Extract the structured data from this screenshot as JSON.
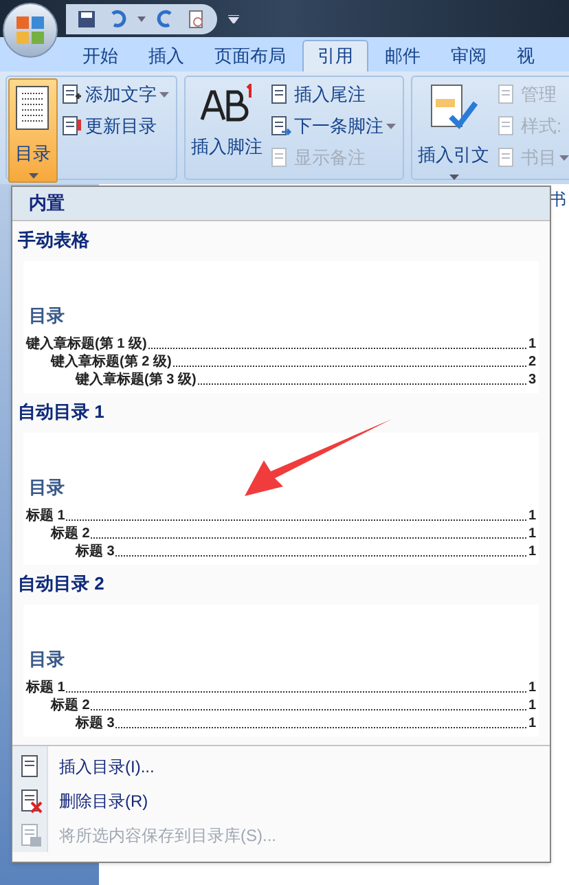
{
  "tabs": [
    {
      "label": "开始",
      "selected": false
    },
    {
      "label": "插入",
      "selected": false
    },
    {
      "label": "页面布局",
      "selected": false
    },
    {
      "label": "引用",
      "selected": true
    },
    {
      "label": "邮件",
      "selected": false
    },
    {
      "label": "审阅",
      "selected": false
    },
    {
      "label": "视",
      "selected": false
    }
  ],
  "ribbon": {
    "groups": [
      {
        "big": {
          "label": "目录",
          "pressed": true,
          "arrow": true
        },
        "small": [
          {
            "label": "添加文字",
            "disabled": false,
            "arrow": true
          },
          {
            "label": "更新目录",
            "disabled": false,
            "arrow": false
          }
        ]
      },
      {
        "big": {
          "label": "插入脚注",
          "pressed": false,
          "arrow": false
        },
        "small": [
          {
            "label": "插入尾注",
            "disabled": false,
            "arrow": false
          },
          {
            "label": "下一条脚注",
            "disabled": false,
            "arrow": true
          },
          {
            "label": "显示备注",
            "disabled": true,
            "arrow": false
          }
        ]
      },
      {
        "big": {
          "label": "插入引文",
          "pressed": false,
          "arrow": true
        },
        "small": [
          {
            "label": "管理",
            "disabled": true,
            "arrow": false
          },
          {
            "label": "样式:",
            "disabled": true,
            "arrow": false
          },
          {
            "label": "书目",
            "disabled": true,
            "arrow": true
          }
        ]
      }
    ],
    "group_label": "书"
  },
  "menu": {
    "header": "内置",
    "gallery": [
      {
        "title": "手动表格",
        "preview_title": "目录",
        "lines": [
          {
            "text": "键入章标题(第 1 级)",
            "page": "1",
            "children": [
              {
                "text": "键入章标题(第 2 级)",
                "page": "2",
                "children": [
                  {
                    "text": "键入章标题(第 3 级)",
                    "page": "3"
                  }
                ]
              }
            ]
          }
        ]
      },
      {
        "title": "自动目录 1",
        "preview_title": "目录",
        "lines": [
          {
            "text": "标题 1",
            "page": "1",
            "children": [
              {
                "text": "标题 2",
                "page": "1",
                "children": [
                  {
                    "text": "标题 3",
                    "page": "1"
                  }
                ]
              }
            ]
          }
        ]
      },
      {
        "title": "自动目录 2",
        "preview_title": "目录",
        "lines": [
          {
            "text": "标题 1",
            "page": "1",
            "children": [
              {
                "text": "标题 2",
                "page": "1",
                "children": [
                  {
                    "text": "标题 3",
                    "page": "1"
                  }
                ]
              }
            ]
          }
        ]
      }
    ],
    "items": [
      {
        "label": "插入目录(I)...",
        "disabled": false
      },
      {
        "label": "删除目录(R)",
        "disabled": false
      },
      {
        "label": "将所选内容保存到目录库(S)...",
        "disabled": true
      }
    ]
  }
}
